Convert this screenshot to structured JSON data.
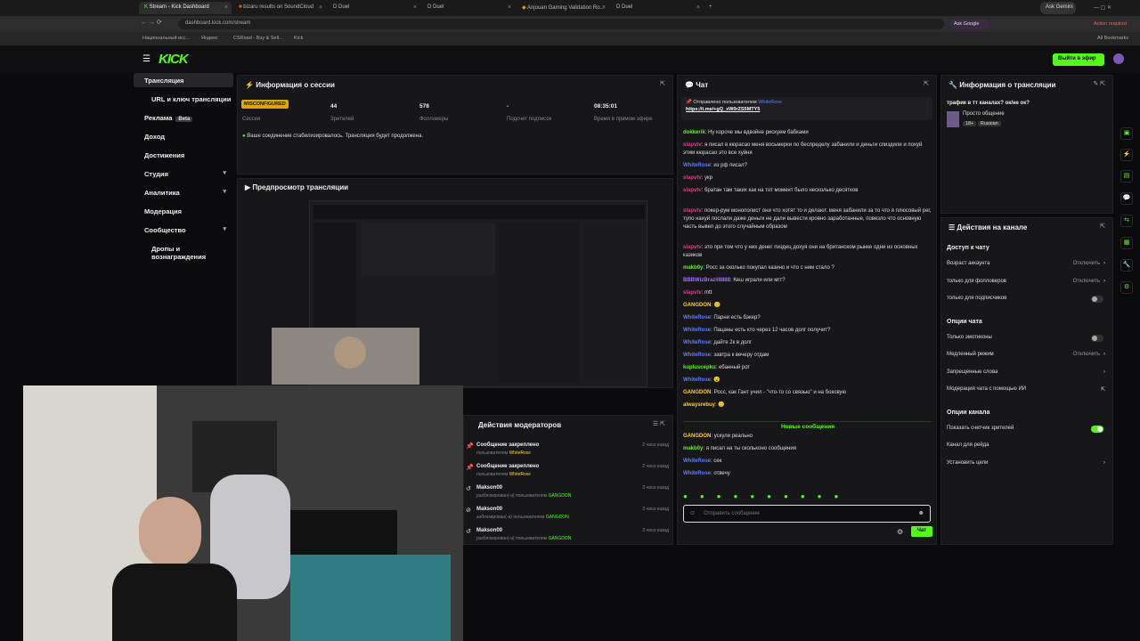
{
  "browser": {
    "tabs": [
      {
        "label": "Stream - Kick Dashboard",
        "active": true
      },
      {
        "label": "bizaru results on SoundCloud"
      },
      {
        "label": "Duel"
      },
      {
        "label": "Duel"
      },
      {
        "label": "Anjouan Gaming Validation Ro..."
      },
      {
        "label": "Duel"
      }
    ],
    "url": "dashboard.kick.com/stream",
    "ask_label": "Ask Google",
    "action_label": "Action required",
    "bookmarks": [
      "Национальный исс...",
      "Яндекс",
      "CSRoad - Buy & Sell...",
      "Kick"
    ],
    "all_bookmarks": "All Bookmarks",
    "top_right_ask": "Ask Gemini"
  },
  "kick": {
    "logo": "KICK",
    "go_live_label": "Выйти в эфир",
    "sidebar": [
      {
        "label": "Трансляция",
        "active": true
      },
      {
        "label": "URL и ключ трансляции"
      },
      {
        "label": "Реклама",
        "badge": "Beta"
      },
      {
        "label": "Доход"
      },
      {
        "label": "Достижения"
      },
      {
        "label": "Студия",
        "chev": "▾"
      },
      {
        "label": "Аналитика",
        "chev": "▾"
      },
      {
        "label": "Модерация"
      },
      {
        "label": "Сообщество",
        "chev": "▾"
      },
      {
        "label": "Дропы и вознаграждения"
      }
    ],
    "session": {
      "title": "Информация о сессии",
      "badge": "MISCONFIGURED",
      "stats": [
        {
          "value": "44",
          "label": "Зрителей"
        },
        {
          "value": "578",
          "label": "Фолловеры"
        },
        {
          "value": "-",
          "label": "Подсчет подписок"
        },
        {
          "value": "08:35:01",
          "label": "Время в прямом эфире"
        }
      ],
      "session_label": "Сессия",
      "notice": "Ваше соединение стабилизировалось. Трансляция будет продолжена."
    },
    "preview": {
      "title": "Предпросмотр трансляции"
    },
    "mod_actions": {
      "title": "Действия модераторов",
      "rows": [
        {
          "title": "Сообщение закреплено",
          "sub": "пользователем",
          "who": "WhiteRose",
          "time": "2 часа назад"
        },
        {
          "title": "Сообщение закреплено",
          "sub": "пользователем",
          "who": "WhiteRose",
          "time": "2 часа назад"
        },
        {
          "title": "Makson00",
          "sub": "разблокирован(-а) пользователем",
          "who": "GANGDON",
          "time": "3 часа назад"
        },
        {
          "title": "Makson00",
          "sub": "заблокирован(-а) пользователем",
          "who": "GANGDON",
          "time": "3 часа назад"
        },
        {
          "title": "Makson00",
          "sub": "разблокирован(-а) пользователем",
          "who": "GANGDON",
          "time": "3 часа назад"
        }
      ]
    },
    "chat": {
      "title": "Чат",
      "pinned_by": "Отправлено пользователем",
      "pinned_user": "WhiteRose",
      "pinned_link": "https://t.me/+gQ_xW0rZS5MTY5",
      "messages": [
        {
          "user": "dokkerik",
          "c": "u3",
          "text": "Ну короче мы вдвойне рискуем бабками"
        },
        {
          "user": "slapvtv",
          "c": "u1",
          "text": "я писал в кюрасао меня восьмерки по беспределу забанили и деньги спиздили и похуй этим кюрасао это все хуйня"
        },
        {
          "user": "WhiteRose",
          "c": "u2",
          "text": "из рф писал?"
        },
        {
          "user": "slapvtv",
          "c": "u1",
          "text": "укр"
        },
        {
          "user": "slapvtv",
          "c": "u1",
          "text": "братан там таких как на тот момент было несколько десятков"
        },
        {
          "user": "slapvtv",
          "c": "u1",
          "text": "покер-рум монополист они что хотят то и делают. меня забанили за то что я плюсовый рег, тупо нахуй послали даже деньги не дали вывести кровно заработанные, повезло что основную часть вывел до этого случайным образом"
        },
        {
          "user": "slapvtv",
          "c": "u1",
          "text": "это при том что у них денег пиздец дохуя они на британском рынке одни из основных казиков"
        },
        {
          "user": "makb0y",
          "c": "u3",
          "text": "Росс за сколько покупал казино и что с ним стало ?"
        },
        {
          "user": "BBBWizBrazil8888",
          "c": "u5",
          "text": "Кеш играли или мгт?"
        },
        {
          "user": "slapvtv",
          "c": "u1",
          "text": "mtt"
        },
        {
          "user": "GANGDON",
          "c": "u4",
          "text": "🙂"
        },
        {
          "user": "WhiteRose",
          "c": "u2",
          "text": "Парни есть бэкер?"
        },
        {
          "user": "WhiteRose",
          "c": "u2",
          "text": "Пацаны есть кто через 12 часов долг получит?"
        },
        {
          "user": "WhiteRose",
          "c": "u2",
          "text": "дайте 2к в долг"
        },
        {
          "user": "WhiteRose",
          "c": "u2",
          "text": "завтра к вечеру отдам"
        },
        {
          "user": "kupluscepku",
          "c": "u3",
          "text": "ебанный рот"
        },
        {
          "user": "WhiteRose",
          "c": "u2",
          "text": "😮"
        },
        {
          "user": "GANGDON",
          "c": "u4",
          "text": "Росс, как Гант учил - \"что-то со связью\" и на боковую"
        },
        {
          "user": "alwaysrebuy",
          "c": "u4",
          "text": "🙂"
        }
      ],
      "new_messages_label": "Новые сообщения",
      "new_messages": [
        {
          "user": "GANGDON",
          "c": "u4",
          "text": "ускули реально"
        },
        {
          "user": "makb0y",
          "c": "u3",
          "text": "я писал на ты скольконо сообщения"
        },
        {
          "user": "WhiteRose",
          "c": "u2",
          "text": "сек"
        },
        {
          "user": "WhiteRose",
          "c": "u2",
          "text": "отвечу"
        }
      ],
      "input_placeholder": "Отправить сообщение",
      "send_label": "Чат"
    },
    "stream_info": {
      "title": "Информация о трансляции",
      "stream_title": "трафик в тт каналах? ок/не ок?",
      "category": "Просто общение",
      "tags": [
        "18+",
        "Russian"
      ]
    },
    "channel_actions": {
      "title": "Действия на канале",
      "sections": [
        {
          "heading": "Доступ к чату",
          "rows": [
            {
              "label": "Возраст аккаунта",
              "value": "Отключить",
              "arrow": "›"
            },
            {
              "label": "только для фолловеров",
              "value": "Отключить",
              "arrow": "›"
            },
            {
              "label": "только для подписчиков",
              "toggle": "off"
            }
          ]
        },
        {
          "heading": "Опции чата",
          "rows": [
            {
              "label": "Только эмотиконы",
              "toggle": "off"
            },
            {
              "label": "Медленный режим",
              "value": "Отключить",
              "arrow": "›"
            },
            {
              "label": "Запрещенные слова",
              "arrow": "›"
            },
            {
              "label": "Модерация чата с помощью ИИ",
              "arrow": "⇱"
            }
          ]
        },
        {
          "heading": "Опции канала",
          "rows": [
            {
              "label": "Показать счетчик зрителей",
              "toggle": "on"
            },
            {
              "label": "Канал для рейда",
              "arrow": ""
            },
            {
              "label": "Установить цели",
              "arrow": "›"
            }
          ]
        }
      ]
    }
  }
}
